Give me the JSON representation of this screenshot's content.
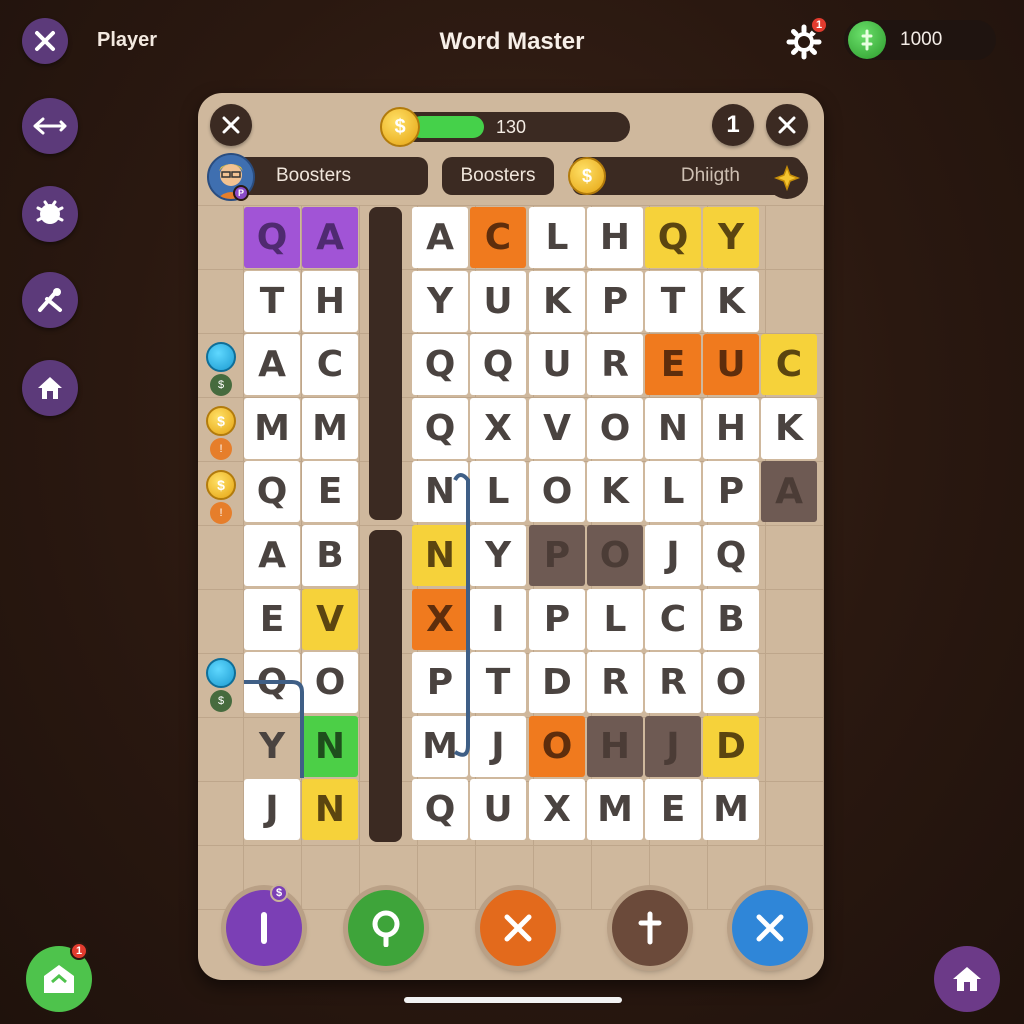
{
  "header": {
    "player_label": "Player",
    "title": "Word Master",
    "settings_badge": "1",
    "currency_amount": "1000"
  },
  "side_nav": [
    {
      "icon": "back-arrow-icon"
    },
    {
      "icon": "bug-icon"
    },
    {
      "icon": "tools-icon"
    },
    {
      "icon": "home-icon"
    }
  ],
  "panel": {
    "progress_value": "130",
    "progress_fraction": 0.35,
    "round": "1",
    "boosters_left": "Boosters",
    "boosters_right": "Boosters",
    "right_pill_text": "Dhiigth",
    "avatar_badge": "P"
  },
  "grid": {
    "rows": [
      [
        "Q",
        "A",
        "",
        "A",
        "C",
        "L",
        "H",
        "Q",
        "Y",
        ""
      ],
      [
        "T",
        "H",
        "",
        "Y",
        "U",
        "K",
        "P",
        "T",
        "K",
        ""
      ],
      [
        "A",
        "C",
        "",
        "Q",
        "Q",
        "U",
        "R",
        "E",
        "U",
        "C"
      ],
      [
        "M",
        "M",
        "",
        "Q",
        "X",
        "V",
        "O",
        "N",
        "H",
        "K"
      ],
      [
        "Q",
        "E",
        "",
        "N",
        "L",
        "O",
        "K",
        "L",
        "P",
        "A"
      ],
      [
        "A",
        "B",
        "",
        "N",
        "Y",
        "P",
        "O",
        "J",
        "Q",
        ""
      ],
      [
        "E",
        "V",
        "",
        "X",
        "I",
        "P",
        "L",
        "C",
        "B",
        ""
      ],
      [
        "Q",
        "O",
        "",
        "P",
        "T",
        "D",
        "R",
        "R",
        "O",
        ""
      ],
      [
        "Y",
        "N",
        "",
        "M",
        "J",
        "O",
        "H",
        "J",
        "D",
        ""
      ],
      [
        "J",
        "N",
        "",
        "Q",
        "U",
        "X",
        "M",
        "E",
        "M",
        ""
      ]
    ],
    "colors": [
      [
        "purple",
        "purple",
        "",
        "white",
        "orange",
        "white",
        "white",
        "yellow",
        "yellow",
        ""
      ],
      [
        "white",
        "white",
        "",
        "white",
        "white",
        "white",
        "white",
        "white",
        "white",
        ""
      ],
      [
        "white",
        "white",
        "",
        "white",
        "white",
        "white",
        "white",
        "orange",
        "orange",
        "yellow"
      ],
      [
        "white",
        "white",
        "",
        "white",
        "white",
        "white",
        "white",
        "white",
        "white",
        "white"
      ],
      [
        "white",
        "white",
        "",
        "white",
        "white",
        "white",
        "white",
        "white",
        "white",
        "dark"
      ],
      [
        "white",
        "white",
        "",
        "yellow",
        "white",
        "dark",
        "dark",
        "white",
        "white",
        ""
      ],
      [
        "white",
        "yellow",
        "",
        "orange",
        "white",
        "white",
        "white",
        "white",
        "white",
        ""
      ],
      [
        "white",
        "white",
        "",
        "white",
        "white",
        "white",
        "white",
        "white",
        "white",
        ""
      ],
      [
        "none",
        "green",
        "",
        "white",
        "white",
        "orange",
        "dark",
        "dark",
        "yellow",
        ""
      ],
      [
        "white",
        "yellow",
        "",
        "white",
        "white",
        "white",
        "white",
        "white",
        "white",
        ""
      ]
    ]
  },
  "actions": [
    {
      "name": "info-action",
      "color": "#7b3fb5",
      "badge": "$"
    },
    {
      "name": "search-action",
      "color": "#3ea43a"
    },
    {
      "name": "clear-action",
      "color": "#e36a1c"
    },
    {
      "name": "add-action",
      "color": "#6b4a3a"
    },
    {
      "name": "cancel-action",
      "color": "#2f86d8"
    }
  ],
  "bottom": {
    "left_badge": "1"
  }
}
